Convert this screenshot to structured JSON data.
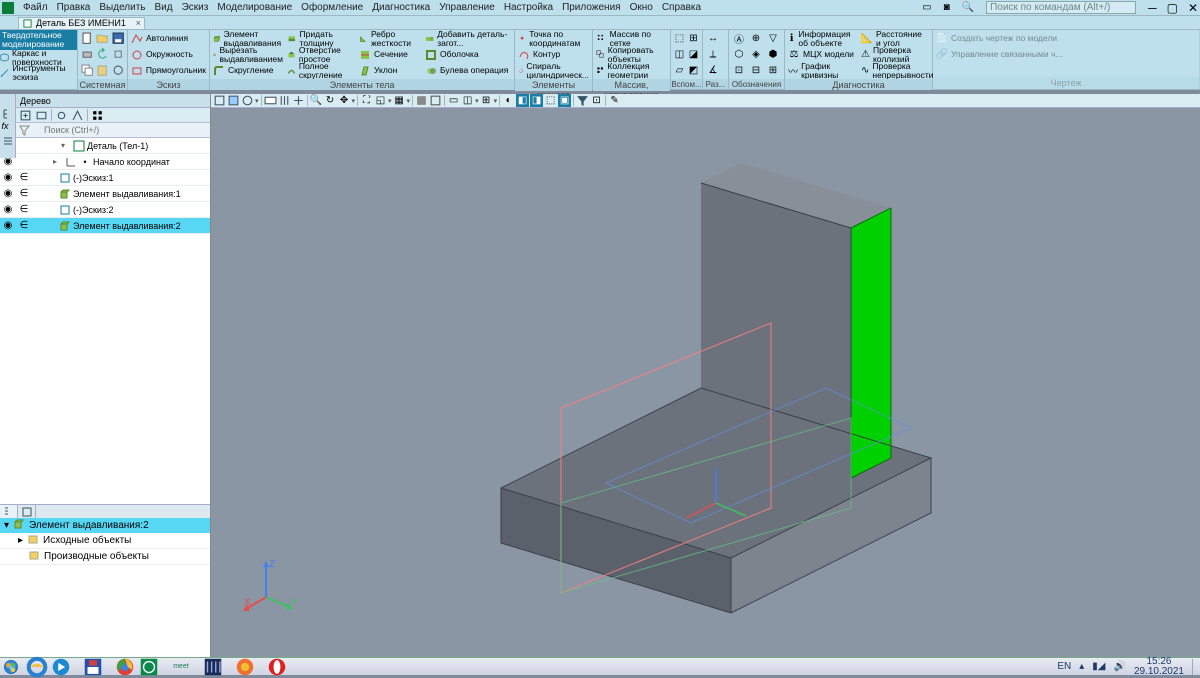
{
  "menu": {
    "items": [
      "Файл",
      "Правка",
      "Выделить",
      "Вид",
      "Эскиз",
      "Моделирование",
      "Оформление",
      "Диагностика",
      "Управление",
      "Настройка",
      "Приложения",
      "Окно",
      "Справка"
    ],
    "search_ph": "Поиск по командам (Alt+/)"
  },
  "tabs": {
    "doc": "Деталь БЕЗ ИМЕНИ1"
  },
  "ribbon": {
    "g1": {
      "lbl": "Системная",
      "items": [
        "",
        "",
        ""
      ]
    },
    "g2": {
      "lbl": "Эскиз",
      "items": [
        "Автолиния",
        "Окружность",
        "Прямоугольник"
      ]
    },
    "g3": {
      "lbl": "",
      "head": "Твердотельное моделирование",
      "items": [
        "Каркас и поверхности",
        "Инструменты эскиза"
      ]
    },
    "g4": {
      "lbl": "Элементы тела",
      "cols": [
        [
          "Элемент выдавливания",
          "Вырезать выдавливанием",
          "Скругление"
        ],
        [
          "Придать толщину",
          "Отверстие простое",
          "Полное скругление"
        ],
        [
          "Ребро жесткости",
          "Сечение",
          "Уклон"
        ],
        [
          "Добавить деталь-загот...",
          "Оболочка",
          "Булева операция"
        ]
      ]
    },
    "g5": {
      "lbl": "Элементы каркаса",
      "cols": [
        [
          "Точка по координатам",
          "Контур",
          "Спираль цилиндрическ..."
        ]
      ]
    },
    "g6": {
      "lbl": "Массив, копирование",
      "items": [
        "Массив по сетке",
        "Копировать объекты",
        "Коллекция геометрии"
      ]
    },
    "g7": {
      "lbl": "Вспом...",
      "w": 30
    },
    "g8": {
      "lbl": "Раз...",
      "w": 26
    },
    "g9": {
      "lbl": "Обозначения",
      "w": 56
    },
    "g10": {
      "lbl": "Диагностика",
      "cols": [
        [
          "Информация об объекте",
          "МЦХ модели",
          "График кривизны"
        ],
        [
          "Расстояние и угол",
          "Проверка коллизий",
          "Проверка непрерывности"
        ]
      ]
    },
    "g11": {
      "lbl": "Чертеж",
      "items": [
        "Создать чертеж по модели",
        "Управление связанными ч..."
      ]
    }
  },
  "left": {
    "panel": "Дерево",
    "search_ph": "Поиск (Ctrl+/)",
    "root": "Деталь (Тел-1)",
    "rows": [
      {
        "t": "Начало координат",
        "k": "origin"
      },
      {
        "t": "(-)Эскиз:1",
        "k": "sketch"
      },
      {
        "t": "Элемент выдавливания:1",
        "k": "extrude"
      },
      {
        "t": "(-)Эскиз:2",
        "k": "sketch"
      },
      {
        "t": "Элемент выдавливания:2",
        "k": "extrude",
        "hi": true
      }
    ],
    "prop": {
      "title": "Элемент выдавливания:2",
      "r1": "Исходные объекты",
      "r2": "Производные объекты"
    }
  },
  "taskbar": {
    "lang": "EN",
    "time": "15:26",
    "date": "29.10.2021"
  }
}
